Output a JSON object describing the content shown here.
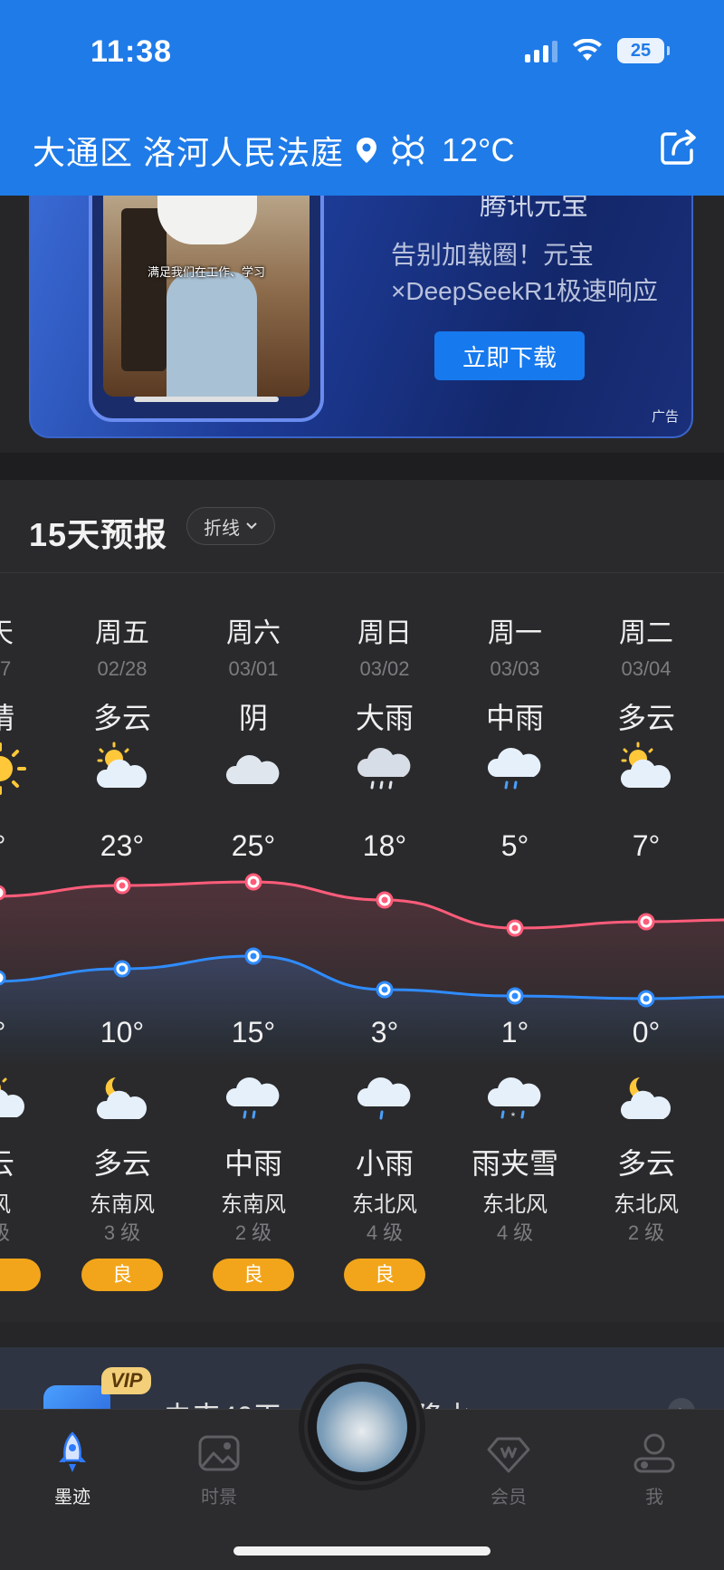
{
  "status_bar": {
    "time": "11:38",
    "battery": "25"
  },
  "header": {
    "location": "大通区 洛河人民法庭",
    "current_temp": "12°C"
  },
  "ad": {
    "title": "腾讯元宝",
    "desc_line1": "告别加载圈！元宝",
    "desc_line2": "×DeepSeekR1极速响应",
    "caption": "满足我们在工作、学习",
    "button": "立即下载",
    "tag": "广告"
  },
  "forecast": {
    "title": "15天预报",
    "mode": "折线",
    "days": [
      {
        "weekday": "天",
        "date": "27",
        "day_cond": "晴",
        "day_icon": "sun-icon",
        "high": "°",
        "low": "°",
        "night_icon": "partly-cloudy-icon",
        "night_cond": "云",
        "wind_dir": "风",
        "wind_level": "级",
        "aqi": ""
      },
      {
        "weekday": "周五",
        "date": "02/28",
        "day_cond": "多云",
        "day_icon": "partly-cloudy-icon",
        "high": "23°",
        "low": "10°",
        "night_icon": "partly-cloudy-night-icon",
        "night_cond": "多云",
        "wind_dir": "东南风",
        "wind_level": "3 级",
        "aqi": "良"
      },
      {
        "weekday": "周六",
        "date": "03/01",
        "day_cond": "阴",
        "day_icon": "cloudy-icon",
        "high": "25°",
        "low": "15°",
        "night_icon": "rain-icon",
        "night_cond": "中雨",
        "wind_dir": "东南风",
        "wind_level": "2 级",
        "aqi": "良"
      },
      {
        "weekday": "周日",
        "date": "03/02",
        "day_cond": "大雨",
        "day_icon": "heavy-rain-icon",
        "high": "18°",
        "low": "3°",
        "night_icon": "light-rain-icon",
        "night_cond": "小雨",
        "wind_dir": "东北风",
        "wind_level": "4 级",
        "aqi": "良"
      },
      {
        "weekday": "周一",
        "date": "03/03",
        "day_cond": "中雨",
        "day_icon": "rain-icon",
        "high": "5°",
        "low": "1°",
        "night_icon": "sleet-icon",
        "night_cond": "雨夹雪",
        "wind_dir": "东北风",
        "wind_level": "4 级",
        "aqi": ""
      },
      {
        "weekday": "周二",
        "date": "03/04",
        "day_cond": "多云",
        "day_icon": "partly-cloudy-icon",
        "high": "7°",
        "low": "0°",
        "night_icon": "partly-cloudy-night-icon",
        "night_cond": "多云",
        "wind_dir": "东北风",
        "wind_level": "2 级",
        "aqi": ""
      }
    ]
  },
  "chart_data": {
    "type": "line",
    "x": [
      "周五",
      "周六",
      "周日",
      "周一",
      "周二"
    ],
    "series": [
      {
        "values": [
          23,
          25,
          18,
          5,
          7
        ],
        "color": "#ff5c7a"
      },
      {
        "values": [
          10,
          15,
          3,
          1,
          0
        ],
        "color": "#2f8cff"
      }
    ]
  },
  "promo": {
    "vip": "VIP",
    "text": "未来40天，温，7天降水"
  },
  "tabbar": {
    "tabs": [
      {
        "label": "墨迹",
        "icon": "rocket-icon"
      },
      {
        "label": "时景",
        "icon": "photo-icon"
      },
      {
        "label": "会员",
        "icon": "vip-diamond-icon"
      },
      {
        "label": "我",
        "icon": "profile-icon"
      }
    ]
  }
}
